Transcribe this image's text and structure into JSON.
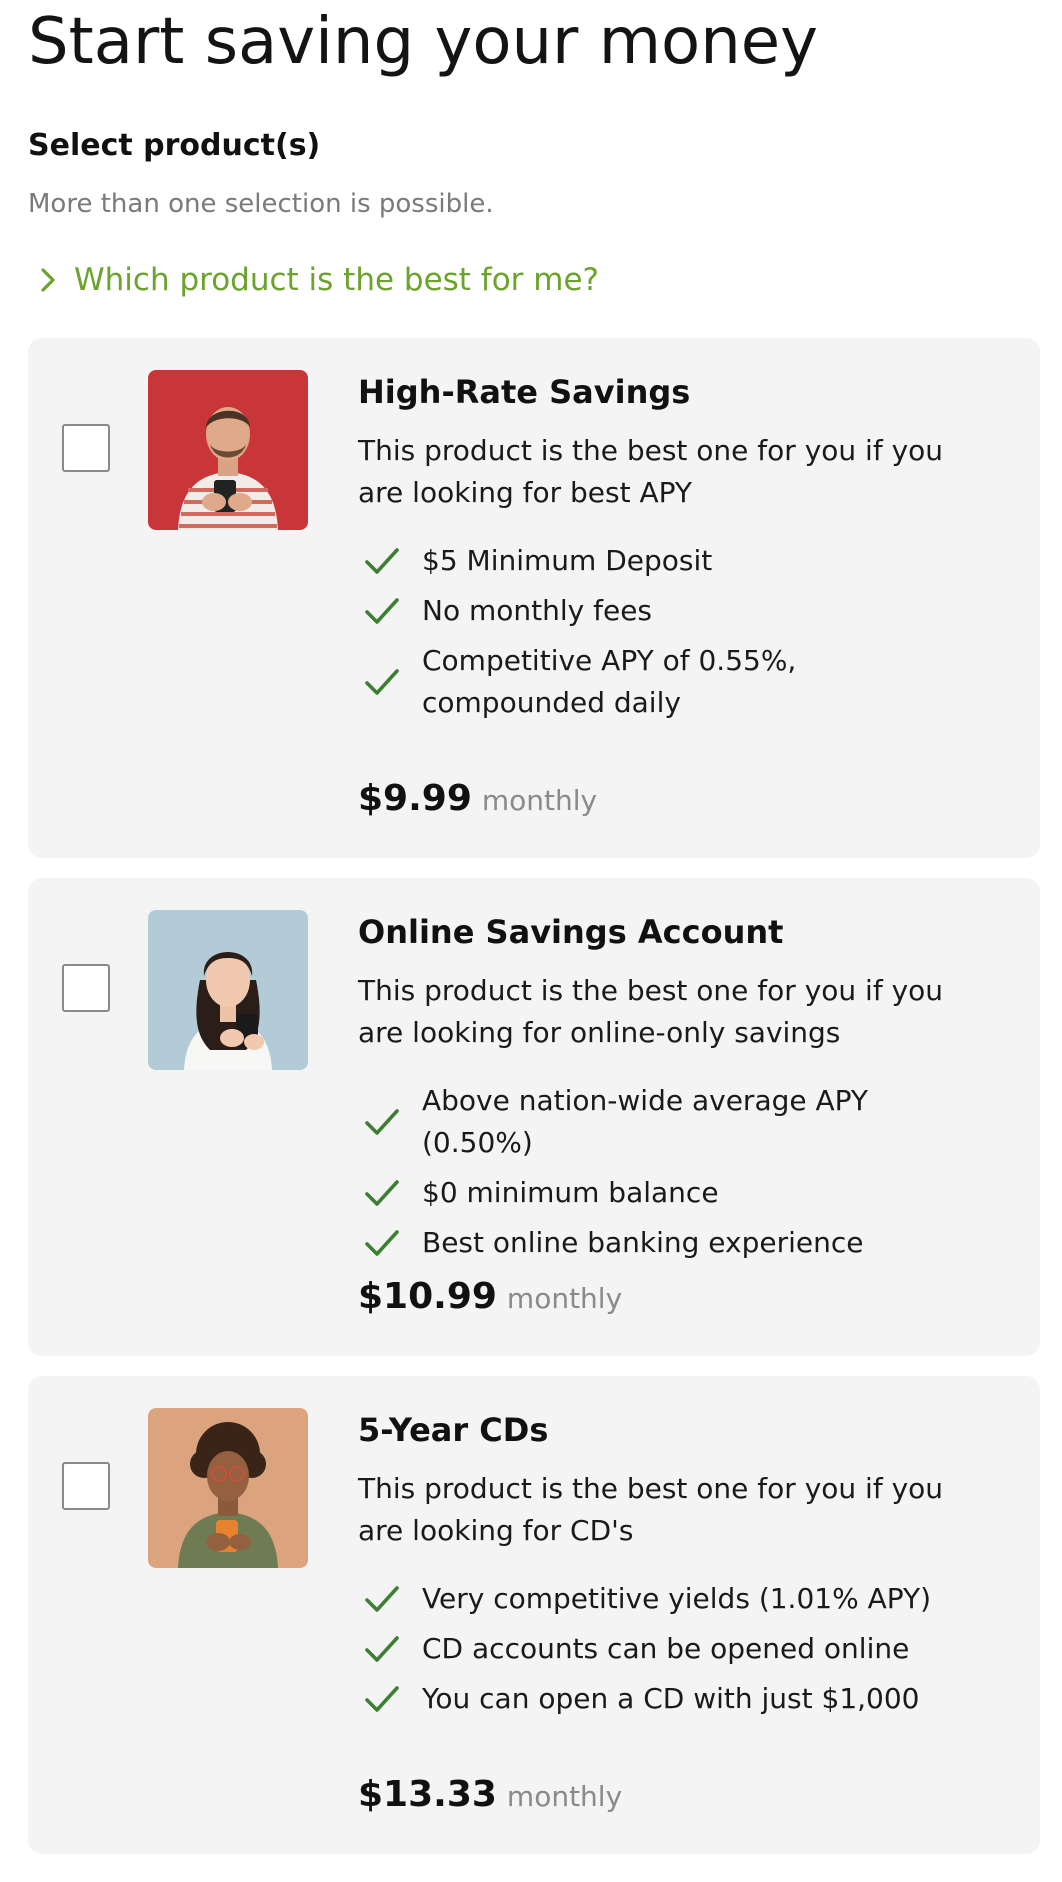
{
  "page_title": "Start saving your money",
  "section": {
    "title": "Select product(s)",
    "hint": "More than one selection is possible."
  },
  "help_link": {
    "label": "Which product is the best for me?"
  },
  "colors": {
    "accent_green": "#6ba32c",
    "check_green": "#3f7f35",
    "card_bg": "#f4f4f4"
  },
  "products": [
    {
      "name": "High-Rate Savings",
      "description": "This product is the best one for you if you are looking for best APY",
      "features": [
        "$5 Minimum Deposit",
        "No monthly fees",
        "Competitive APY of 0.55%, compounded daily"
      ],
      "price": "$9.99",
      "period": "monthly",
      "checked": false,
      "photo_icon": "man-with-phone-photo"
    },
    {
      "name": "Online Savings Account",
      "description": "This product is the best one for you if you are looking for online-only savings",
      "features": [
        "Above nation-wide average APY (0.50%)",
        "$0 minimum balance",
        "Best online banking experience"
      ],
      "price": "$10.99",
      "period": "monthly",
      "checked": false,
      "photo_icon": "girl-with-phone-photo"
    },
    {
      "name": "5-Year CDs",
      "description": "This product is the best one for you if you are looking for CD's",
      "features": [
        "Very competitive yields (1.01% APY)",
        "CD accounts can be opened online",
        "You can open a CD with just $1,000"
      ],
      "price": "$13.33",
      "period": "monthly",
      "checked": false,
      "photo_icon": "woman-with-phone-photo"
    }
  ]
}
